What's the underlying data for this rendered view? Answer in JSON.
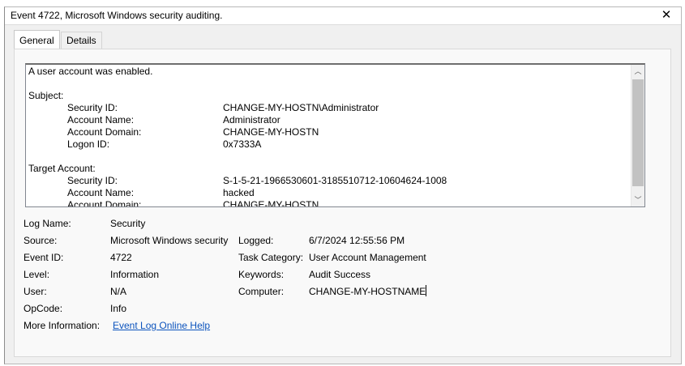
{
  "window": {
    "title": "Event 4722, Microsoft Windows security auditing.",
    "close_glyph": "✕"
  },
  "tabs": [
    {
      "label": "General",
      "active": true
    },
    {
      "label": "Details",
      "active": false
    }
  ],
  "description": {
    "headline": "A user account was enabled.",
    "subject_header": "Subject:",
    "subject": [
      {
        "key": "Security ID:",
        "value": "CHANGE-MY-HOSTN\\Administrator"
      },
      {
        "key": "Account Name:",
        "value": "Administrator"
      },
      {
        "key": "Account Domain:",
        "value": "CHANGE-MY-HOSTN"
      },
      {
        "key": "Logon ID:",
        "value": "0x7333A"
      }
    ],
    "target_header": "Target Account:",
    "target": [
      {
        "key": "Security ID:",
        "value": "S-1-5-21-1966530601-3185510712-10604624-1008"
      },
      {
        "key": "Account Name:",
        "value": "hacked"
      },
      {
        "key": "Account Domain:",
        "value": "CHANGE-MY-HOSTN"
      }
    ]
  },
  "scrollbar": {
    "up_glyph": "︿",
    "down_glyph": "﹀"
  },
  "properties": {
    "log_name_label": "Log Name:",
    "log_name": "Security",
    "source_label": "Source:",
    "source": "Microsoft Windows security",
    "logged_label": "Logged:",
    "logged": "6/7/2024 12:55:56 PM",
    "event_id_label": "Event ID:",
    "event_id": "4722",
    "task_category_label": "Task Category:",
    "task_category": "User Account Management",
    "level_label": "Level:",
    "level": "Information",
    "keywords_label": "Keywords:",
    "keywords": "Audit Success",
    "user_label": "User:",
    "user": "N/A",
    "computer_label": "Computer:",
    "computer": "CHANGE-MY-HOSTNAME",
    "opcode_label": "OpCode:",
    "opcode": "Info",
    "more_info_label": "More Information:",
    "more_info_link": "Event Log Online Help"
  }
}
